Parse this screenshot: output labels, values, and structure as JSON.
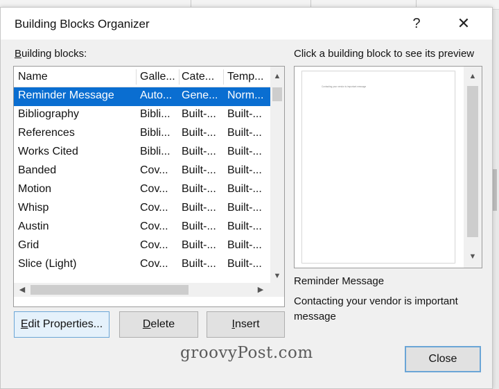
{
  "dialog": {
    "title": "Building Blocks Organizer",
    "help_symbol": "?",
    "close_symbol": "✕"
  },
  "list": {
    "label_accesskey": "B",
    "label_rest": "uilding blocks:",
    "columns": [
      "Name",
      "Galle...",
      "Cate...",
      "Temp..."
    ],
    "rows": [
      {
        "name": "Reminder Message",
        "gallery": "Auto...",
        "category": "Gene...",
        "template": "Norm..."
      },
      {
        "name": "Bibliography",
        "gallery": "Bibli...",
        "category": "Built-...",
        "template": "Built-..."
      },
      {
        "name": "References",
        "gallery": "Bibli...",
        "category": "Built-...",
        "template": "Built-..."
      },
      {
        "name": "Works Cited",
        "gallery": "Bibli...",
        "category": "Built-...",
        "template": "Built-..."
      },
      {
        "name": "Banded",
        "gallery": "Cov...",
        "category": "Built-...",
        "template": "Built-..."
      },
      {
        "name": "Motion",
        "gallery": "Cov...",
        "category": "Built-...",
        "template": "Built-..."
      },
      {
        "name": "Whisp",
        "gallery": "Cov...",
        "category": "Built-...",
        "template": "Built-..."
      },
      {
        "name": "Austin",
        "gallery": "Cov...",
        "category": "Built-...",
        "template": "Built-..."
      },
      {
        "name": "Grid",
        "gallery": "Cov...",
        "category": "Built-...",
        "template": "Built-..."
      },
      {
        "name": "Slice (Light)",
        "gallery": "Cov...",
        "category": "Built-...",
        "template": "Built-..."
      }
    ],
    "selected_index": 0
  },
  "buttons": {
    "edit_accesskey": "E",
    "edit_rest": "dit Properties...",
    "delete_accesskey": "D",
    "delete_rest": "elete",
    "insert_accesskey": "I",
    "insert_rest": "nsert",
    "close": "Close"
  },
  "preview": {
    "label": "Click a building block to see its preview",
    "page_text": "Contacting your vendor is important message",
    "name": "Reminder Message",
    "description": "Contacting your vendor is important message"
  },
  "watermark": "groovyPost.com",
  "colors": {
    "selection": "#0a6ed1",
    "dialog_bg": "#f0f0f0",
    "default_button_border": "#6aa5d6"
  }
}
